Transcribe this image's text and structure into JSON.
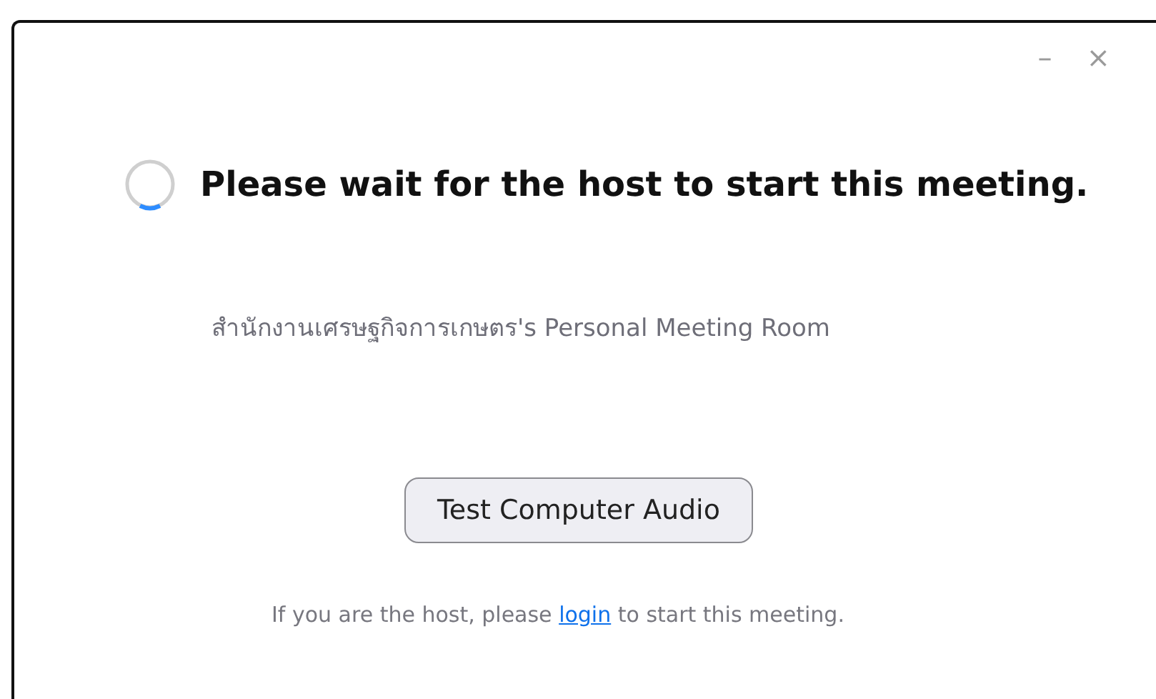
{
  "window_controls": [
    "–",
    "×"
  ],
  "waiting_message": "Please wait for the host to start this meeting.",
  "room_name": "สำนักงานเศรษฐกิจการเกษตร's Personal Meeting Room",
  "test_audio_button": "Test Computer Audio",
  "host_hint": {
    "before": "If you are the host, please ",
    "link": "login",
    "after": " to start this meeting."
  }
}
